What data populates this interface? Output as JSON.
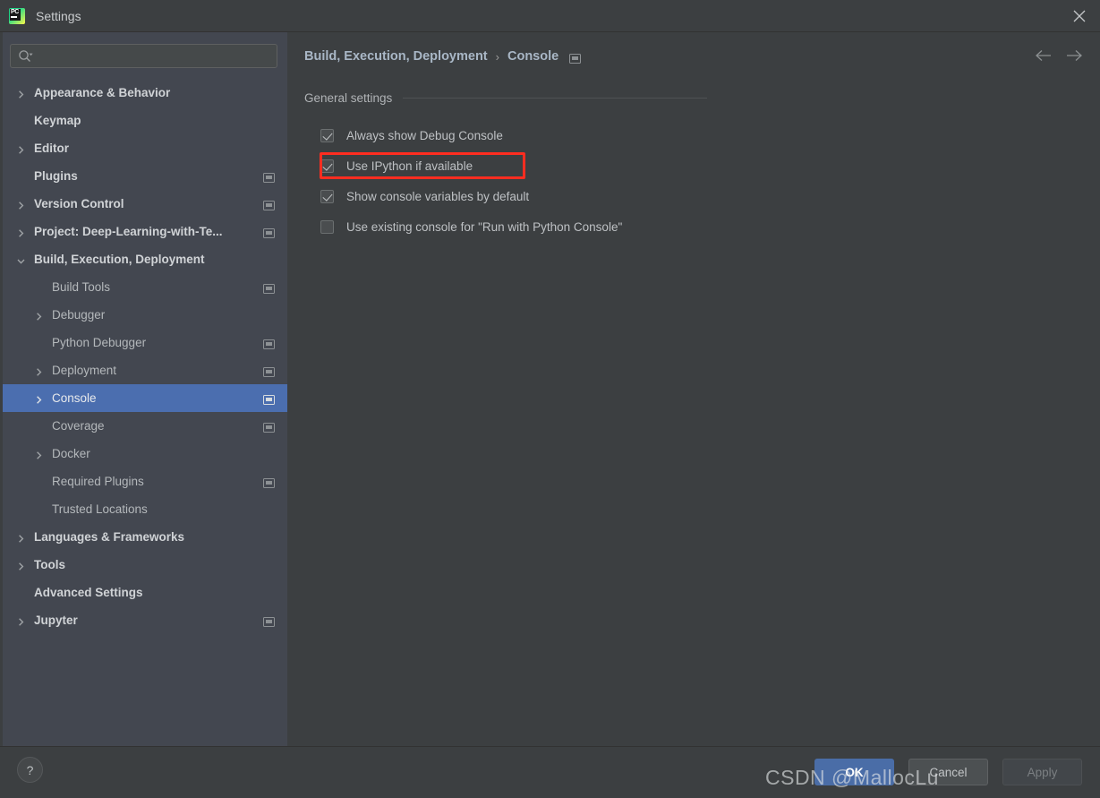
{
  "window": {
    "title": "Settings",
    "app_icon": "pycharm-icon",
    "close_icon": "close-icon"
  },
  "sidebar": {
    "search": {
      "placeholder": "",
      "value": "",
      "icon": "search-icon"
    },
    "items": [
      {
        "label": "Appearance & Behavior",
        "indent": 0,
        "arrow": "right",
        "bold": true,
        "badge": false,
        "selected": false
      },
      {
        "label": "Keymap",
        "indent": 0,
        "arrow": "none",
        "bold": true,
        "badge": false,
        "selected": false
      },
      {
        "label": "Editor",
        "indent": 0,
        "arrow": "right",
        "bold": true,
        "badge": false,
        "selected": false
      },
      {
        "label": "Plugins",
        "indent": 0,
        "arrow": "none",
        "bold": true,
        "badge": true,
        "selected": false
      },
      {
        "label": "Version Control",
        "indent": 0,
        "arrow": "right",
        "bold": true,
        "badge": true,
        "selected": false
      },
      {
        "label": "Project: Deep-Learning-with-Te...",
        "indent": 0,
        "arrow": "right",
        "bold": true,
        "badge": true,
        "selected": false
      },
      {
        "label": "Build, Execution, Deployment",
        "indent": 0,
        "arrow": "down",
        "bold": true,
        "badge": false,
        "selected": false
      },
      {
        "label": "Build Tools",
        "indent": 1,
        "arrow": "none",
        "bold": false,
        "badge": true,
        "selected": false
      },
      {
        "label": "Debugger",
        "indent": 1,
        "arrow": "right",
        "bold": false,
        "badge": false,
        "selected": false
      },
      {
        "label": "Python Debugger",
        "indent": 1,
        "arrow": "none",
        "bold": false,
        "badge": true,
        "selected": false
      },
      {
        "label": "Deployment",
        "indent": 1,
        "arrow": "right",
        "bold": false,
        "badge": true,
        "selected": false
      },
      {
        "label": "Console",
        "indent": 1,
        "arrow": "right",
        "bold": false,
        "badge": true,
        "selected": true
      },
      {
        "label": "Coverage",
        "indent": 1,
        "arrow": "none",
        "bold": false,
        "badge": true,
        "selected": false
      },
      {
        "label": "Docker",
        "indent": 1,
        "arrow": "right",
        "bold": false,
        "badge": false,
        "selected": false
      },
      {
        "label": "Required Plugins",
        "indent": 1,
        "arrow": "none",
        "bold": false,
        "badge": true,
        "selected": false
      },
      {
        "label": "Trusted Locations",
        "indent": 1,
        "arrow": "none",
        "bold": false,
        "badge": false,
        "selected": false
      },
      {
        "label": "Languages & Frameworks",
        "indent": 0,
        "arrow": "right",
        "bold": true,
        "badge": false,
        "selected": false
      },
      {
        "label": "Tools",
        "indent": 0,
        "arrow": "right",
        "bold": true,
        "badge": false,
        "selected": false
      },
      {
        "label": "Advanced Settings",
        "indent": 0,
        "arrow": "none",
        "bold": true,
        "badge": false,
        "selected": false
      },
      {
        "label": "Jupyter",
        "indent": 0,
        "arrow": "right",
        "bold": true,
        "badge": true,
        "selected": false
      }
    ]
  },
  "content": {
    "breadcrumb": {
      "parent": "Build, Execution, Deployment",
      "separator": "›",
      "current": "Console",
      "badge_icon": "project-settings-icon"
    },
    "nav": {
      "back_icon": "arrow-left-icon",
      "forward_icon": "arrow-right-icon"
    },
    "section_title": "General settings",
    "options": [
      {
        "label": "Always show Debug Console",
        "checked": true
      },
      {
        "label": "Use IPython if available",
        "checked": true
      },
      {
        "label": "Show console variables by default",
        "checked": true
      },
      {
        "label": "Use existing console for \"Run with Python Console\"",
        "checked": false
      }
    ],
    "highlight": {
      "target": "Use IPython if available",
      "color": "#ff2d20"
    }
  },
  "footer": {
    "help_label": "?",
    "help_icon": "help-icon",
    "ok_label": "OK",
    "cancel_label": "Cancel",
    "apply_label": "Apply",
    "apply_enabled": false
  },
  "watermark": {
    "text": "CSDN @MallocLu"
  },
  "colors": {
    "window_bg": "#3c3f41",
    "sidebar_bg": "#434750",
    "selection": "#4b6eaf",
    "accent_button": "#4a6da7",
    "highlight_red": "#ff2d20",
    "text_primary": "#bec1c4",
    "text_bold": "#d0d3d6"
  }
}
